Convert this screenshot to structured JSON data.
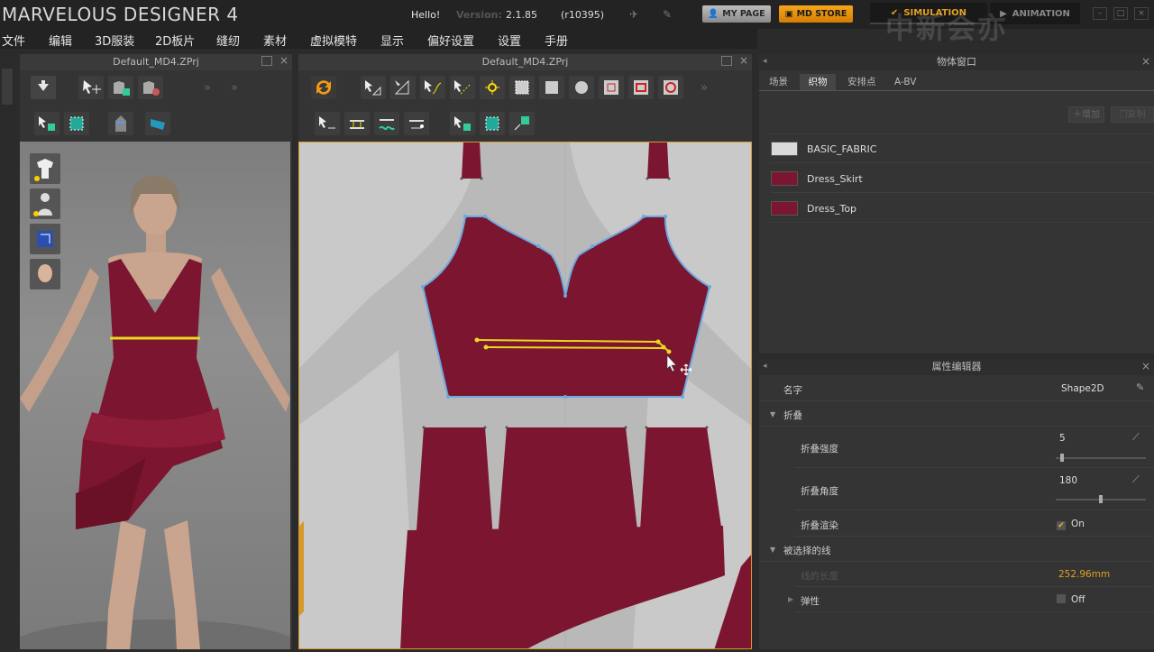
{
  "app": {
    "title": "MARVELOUS DESIGNER 4",
    "hello": "Hello!",
    "version_label": "Version:",
    "version": "2.1.85",
    "build": "(r10395)",
    "my_page": "MY PAGE",
    "md_store": "MD STORE",
    "simulation": "SIMULATION",
    "animation": "ANIMATION",
    "watermark": "中新会亦"
  },
  "menu": [
    "文件",
    "编辑",
    "3D服装",
    "2D板片",
    "缝纫",
    "素材",
    "虚拟模特",
    "显示",
    "偏好设置",
    "设置",
    "手册"
  ],
  "left_panel": {
    "title": "Default_MD4.ZPrj"
  },
  "mid_panel": {
    "title": "Default_MD4.ZPrj"
  },
  "object_window": {
    "title": "物体窗口",
    "tabs": [
      "场景",
      "织物",
      "安排点",
      "A-BV"
    ],
    "active_tab": "织物",
    "add_label": "增加",
    "copy_label": "复制",
    "fabrics": [
      {
        "name": "BASIC_FABRIC",
        "color": "#d9d9d9"
      },
      {
        "name": "Dress_Skirt",
        "color": "#7c1530"
      },
      {
        "name": "Dress_Top",
        "color": "#7c1530"
      }
    ]
  },
  "property_editor": {
    "title": "属性编辑器",
    "name_label": "名字",
    "name_value": "Shape2D",
    "fold_section": "折叠",
    "fold_strength_label": "折叠强度",
    "fold_strength_value": "5",
    "fold_strength_level": 0.05,
    "fold_angle_label": "折叠角度",
    "fold_angle_value": "180",
    "fold_angle_level": 0.5,
    "fold_render_label": "折叠渲染",
    "fold_render_value": "On",
    "selected_line_section": "被选择的线",
    "line_length_label": "线的长度",
    "line_length_value": "252.96mm",
    "elastic_label": "弹性",
    "elastic_value": "Off"
  },
  "colors": {
    "fabric": "#7c1530",
    "accent": "#e0a020",
    "selection": "#6aa8e0",
    "fold_line": "#e8d820"
  }
}
